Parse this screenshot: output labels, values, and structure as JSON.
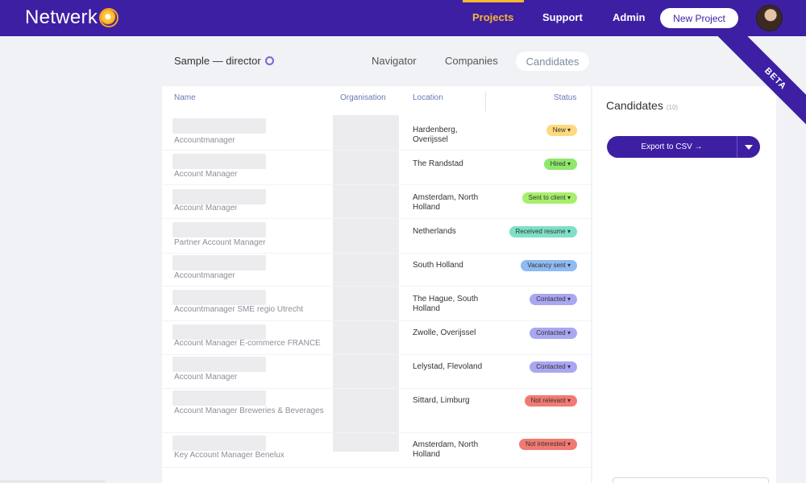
{
  "header": {
    "logo": "Netwerk",
    "nav": [
      "Projects",
      "Support",
      "Admin"
    ],
    "active_nav": "Projects",
    "new_project_label": "New Project"
  },
  "project": {
    "title": "Sample — director",
    "tabs": [
      "Navigator",
      "Companies",
      "Candidates"
    ],
    "active_tab": "Candidates"
  },
  "ribbon": "BETA",
  "table": {
    "columns": [
      "Name",
      "Organisation",
      "Location",
      "Status"
    ],
    "rows": [
      {
        "name": "Accountmanager",
        "location": "Hardenberg, Overijssel",
        "status": "New ▾",
        "status_color": "#ffd980"
      },
      {
        "name": "Account Manager",
        "location": "The Randstad",
        "status": "Hired ▾",
        "status_color": "#8ee86a"
      },
      {
        "name": "Account Manager",
        "location": "Amsterdam, North Holland",
        "status": "Sent to client ▾",
        "status_color": "#a6ef6a"
      },
      {
        "name": "Partner Account Manager",
        "location": "Netherlands",
        "status": "Received resume ▾",
        "status_color": "#7ee0c5"
      },
      {
        "name": "Accountmanager",
        "location": "South Holland",
        "status": "Vacancy sent ▾",
        "status_color": "#8fbaf2"
      },
      {
        "name": "Accountmanager SME regio Utrecht",
        "location": "The Hague, South Holland",
        "status": "Contacted ▾",
        "status_color": "#a9a7f2"
      },
      {
        "name": "Account Manager E-commerce FRANCE",
        "location": "Zwolle, Overijssel",
        "status": "Contacted ▾",
        "status_color": "#a9a7f2"
      },
      {
        "name": "Account Manager",
        "location": "Lelystad, Flevoland",
        "status": "Contacted ▾",
        "status_color": "#a9a7f2"
      },
      {
        "name": "Account Manager Breweries & Beverages",
        "location": "Sittard, Limburg",
        "status": "Not relevant ▾",
        "status_color": "#f27a72"
      },
      {
        "name": "Key Account Manager Benelux",
        "location": "Amsterdam, North Holland",
        "status": "Not interested ▾",
        "status_color": "#f27a72"
      }
    ]
  },
  "panel": {
    "title": "Candidates",
    "count": "(10)",
    "export_label": "Export to CSV →"
  }
}
